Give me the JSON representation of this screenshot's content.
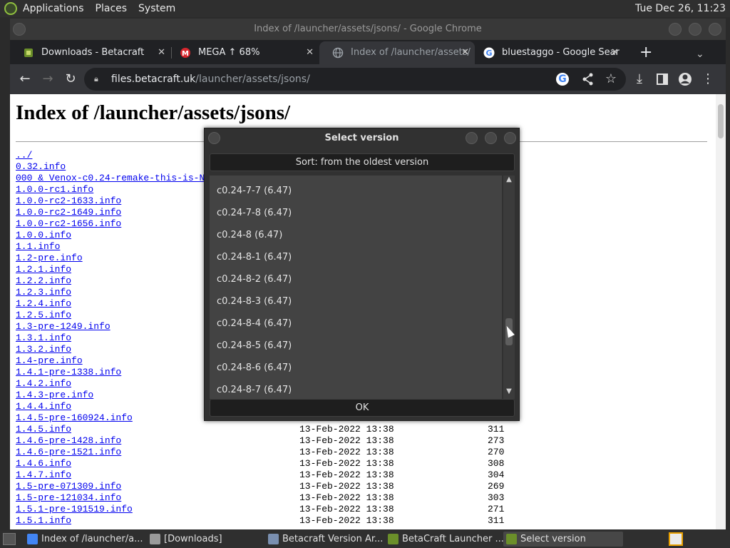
{
  "panel": {
    "menus": [
      "Applications",
      "Places",
      "System"
    ],
    "clock": "Tue Dec 26, 11:23"
  },
  "chrome": {
    "window_title": "Index of /launcher/assets/jsons/ - Google Chrome",
    "tabs": [
      {
        "label": "Downloads - Betacraft",
        "favicon_icon": "betacraft-icon",
        "color": "#6b8f2a"
      },
      {
        "label": "MEGA ↑ 68%",
        "favicon_icon": "mega-icon",
        "color": "#d9272e"
      },
      {
        "label": "Index of /launcher/assets/",
        "favicon_icon": "globe-icon",
        "color": "#9aa0a6"
      },
      {
        "label": "bluestaggo - Google Sear",
        "favicon_icon": "google-icon",
        "color": "#4285f4"
      }
    ],
    "url_domain": "files.betacraft.uk",
    "url_path": "/launcher/assets/jsons/"
  },
  "page": {
    "heading": "Index of /launcher/assets/jsons/",
    "files": [
      {
        "name": "../",
        "date": "",
        "size": ""
      },
      {
        "name": "0.32.info",
        "date": "",
        "size": ""
      },
      {
        "name": "000_&_Venox-c0.24-remake-this-is-N",
        "date": "",
        "size": ""
      },
      {
        "name": "1.0.0-rc1.info",
        "date": "",
        "size": ""
      },
      {
        "name": "1.0.0-rc2-1633.info",
        "date": "",
        "size": ""
      },
      {
        "name": "1.0.0-rc2-1649.info",
        "date": "",
        "size": ""
      },
      {
        "name": "1.0.0-rc2-1656.info",
        "date": "",
        "size": ""
      },
      {
        "name": "1.0.0.info",
        "date": "",
        "size": ""
      },
      {
        "name": "1.1.info",
        "date": "",
        "size": ""
      },
      {
        "name": "1.2-pre.info",
        "date": "",
        "size": ""
      },
      {
        "name": "1.2.1.info",
        "date": "",
        "size": ""
      },
      {
        "name": "1.2.2.info",
        "date": "",
        "size": ""
      },
      {
        "name": "1.2.3.info",
        "date": "",
        "size": ""
      },
      {
        "name": "1.2.4.info",
        "date": "",
        "size": ""
      },
      {
        "name": "1.2.5.info",
        "date": "",
        "size": ""
      },
      {
        "name": "1.3-pre-1249.info",
        "date": "",
        "size": ""
      },
      {
        "name": "1.3.1.info",
        "date": "",
        "size": ""
      },
      {
        "name": "1.3.2.info",
        "date": "",
        "size": ""
      },
      {
        "name": "1.4-pre.info",
        "date": "",
        "size": ""
      },
      {
        "name": "1.4.1-pre-1338.info",
        "date": "",
        "size": ""
      },
      {
        "name": "1.4.2.info",
        "date": "",
        "size": ""
      },
      {
        "name": "1.4.3-pre.info",
        "date": "",
        "size": ""
      },
      {
        "name": "1.4.4.info",
        "date": "",
        "size": ""
      },
      {
        "name": "1.4.5-pre-160924.info",
        "date": "",
        "size": ""
      },
      {
        "name": "1.4.5.info",
        "date": "13-Feb-2022 13:38",
        "size": "311"
      },
      {
        "name": "1.4.6-pre-1428.info",
        "date": "13-Feb-2022 13:38",
        "size": "273"
      },
      {
        "name": "1.4.6-pre-1521.info",
        "date": "13-Feb-2022 13:38",
        "size": "270"
      },
      {
        "name": "1.4.6.info",
        "date": "13-Feb-2022 13:38",
        "size": "308"
      },
      {
        "name": "1.4.7.info",
        "date": "13-Feb-2022 13:38",
        "size": "304"
      },
      {
        "name": "1.5-pre-071309.info",
        "date": "13-Feb-2022 13:38",
        "size": "269"
      },
      {
        "name": "1.5-pre-121034.info",
        "date": "13-Feb-2022 13:38",
        "size": "303"
      },
      {
        "name": "1.5.1-pre-191519.info",
        "date": "13-Feb-2022 13:38",
        "size": "271"
      },
      {
        "name": "1.5.1.info",
        "date": "13-Feb-2022 13:38",
        "size": "311"
      }
    ]
  },
  "dialog": {
    "title": "Select version",
    "sort_label": "Sort: from the oldest version",
    "versions": [
      "c0.24-7-7 (6.47)",
      "c0.24-7-8 (6.47)",
      "c0.24-8 (6.47)",
      "c0.24-8-1 (6.47)",
      "c0.24-8-2 (6.47)",
      "c0.24-8-3 (6.47)",
      "c0.24-8-4 (6.47)",
      "c0.24-8-5 (6.47)",
      "c0.24-8-6 (6.47)",
      "c0.24-8-7 (6.47)"
    ],
    "ok_label": "OK"
  },
  "taskbar": {
    "tasks": [
      {
        "label": "Index of /launcher/a...",
        "icon": "chrome-icon",
        "color": "#4285f4"
      },
      {
        "label": "[Downloads]",
        "icon": "folder-icon",
        "color": "#9a9a9a"
      },
      {
        "label": "Betacraft Version Ar...",
        "icon": "archive-icon",
        "color": "#7a8fb0"
      },
      {
        "label": "BetaCraft Launcher ...",
        "icon": "java-icon",
        "color": "#6b8f2a"
      },
      {
        "label": "Select version",
        "icon": "java-icon",
        "color": "#6b8f2a"
      }
    ]
  }
}
